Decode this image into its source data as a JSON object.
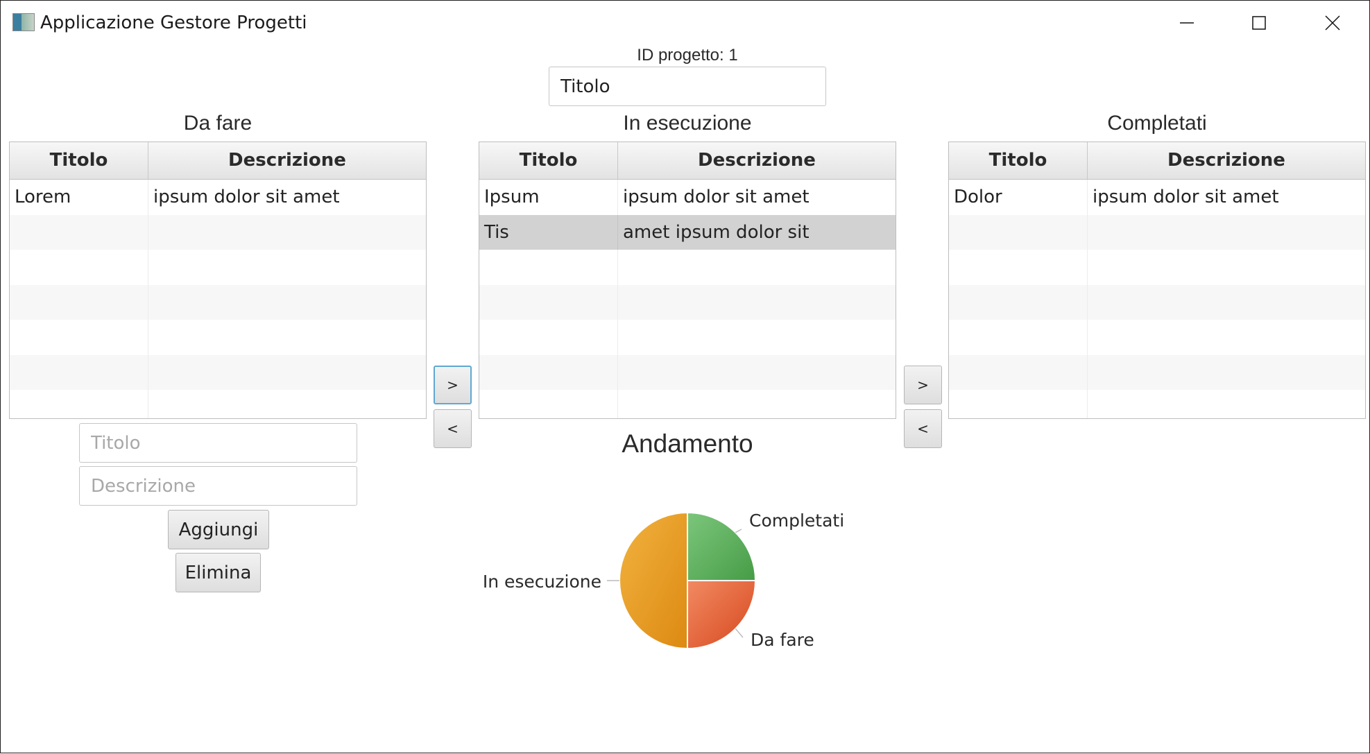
{
  "window": {
    "title": "Applicazione Gestore Progetti",
    "controls": [
      "minimize-icon",
      "maximize-icon",
      "close-icon"
    ]
  },
  "project": {
    "id_label": "ID progetto: 1",
    "title_value": "Titolo"
  },
  "columns": {
    "todo": {
      "heading": "Da fare",
      "headers": [
        "Titolo",
        "Descrizione"
      ],
      "rows": [
        [
          "Lorem",
          "ipsum dolor sit amet"
        ]
      ]
    },
    "doing": {
      "heading": "In esecuzione",
      "headers": [
        "Titolo",
        "Descrizione"
      ],
      "rows": [
        [
          "Ipsum",
          "ipsum dolor sit amet"
        ],
        [
          "Tis",
          "amet ipsum dolor sit"
        ]
      ],
      "selected_row": 1
    },
    "done": {
      "heading": "Completati",
      "headers": [
        "Titolo",
        "Descrizione"
      ],
      "rows": [
        [
          "Dolor",
          "ipsum dolor sit amet"
        ]
      ]
    }
  },
  "form": {
    "title_placeholder": "Titolo",
    "desc_placeholder": "Descrizione",
    "add_label": "Aggiungi",
    "delete_label": "Elimina"
  },
  "move_buttons": {
    "right": ">",
    "left": "<"
  },
  "chart_data": {
    "type": "pie",
    "title": "Andamento",
    "slices": [
      {
        "label": "Completati",
        "value": 1,
        "color": "#5aae5a"
      },
      {
        "label": "Da fare",
        "value": 1,
        "color": "#e5673a"
      },
      {
        "label": "In esecuzione",
        "value": 2,
        "color": "#eba12e"
      }
    ]
  }
}
